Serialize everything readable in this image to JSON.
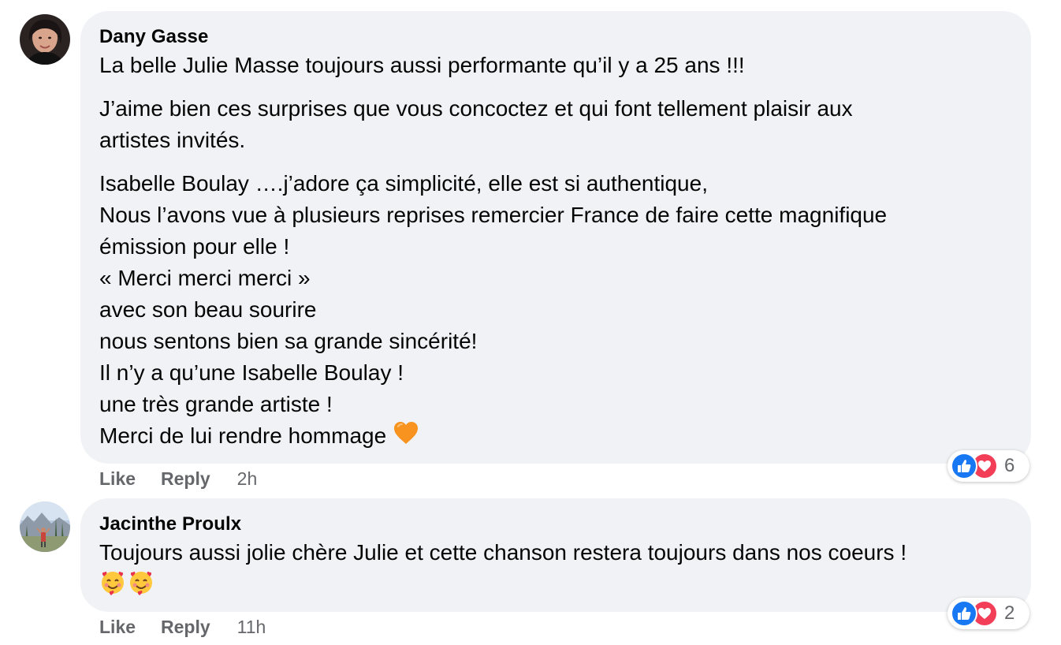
{
  "comments": [
    {
      "author": "Dany Gasse",
      "paragraphs": [
        [
          "La belle Julie Masse toujours aussi performante qu’il y a 25 ans !!!"
        ],
        [
          "J’aime bien ces surprises que vous concoctez et qui font tellement plaisir aux",
          "artistes invités."
        ],
        [
          "Isabelle Boulay ….j’adore ça simplicité, elle est si authentique,",
          "Nous l’avons vue à plusieurs reprises remercier France de faire cette magnifique",
          "émission pour elle !",
          "« Merci merci merci »",
          "avec son beau sourire",
          "nous sentons bien sa grande sincérité!",
          "Il n’y a qu’une Isabelle Boulay !",
          "une très grande artiste !",
          "Merci de lui rendre hommage"
        ]
      ],
      "trailing_emoji": "orange-heart-emoji",
      "actions": {
        "like": "Like",
        "reply": "Reply",
        "time": "2h"
      },
      "reactions": {
        "types": [
          "like",
          "love"
        ],
        "count": "6"
      }
    },
    {
      "author": "Jacinthe Proulx",
      "paragraphs": [
        [
          "Toujours aussi jolie chère Julie et cette chanson restera toujours dans nos coeurs !"
        ]
      ],
      "emoji_line": [
        "smiling-face-with-hearts-emoji",
        "smiling-face-with-hearts-emoji"
      ],
      "actions": {
        "like": "Like",
        "reply": "Reply",
        "time": "11h"
      },
      "reactions": {
        "types": [
          "like",
          "love"
        ],
        "count": "2"
      }
    }
  ],
  "colors": {
    "bubble": "#f0f2f5",
    "secondary_text": "#65676b",
    "like_blue": "#1877f2",
    "love_red": "#f33e58",
    "orange_heart": "#f7931e"
  }
}
